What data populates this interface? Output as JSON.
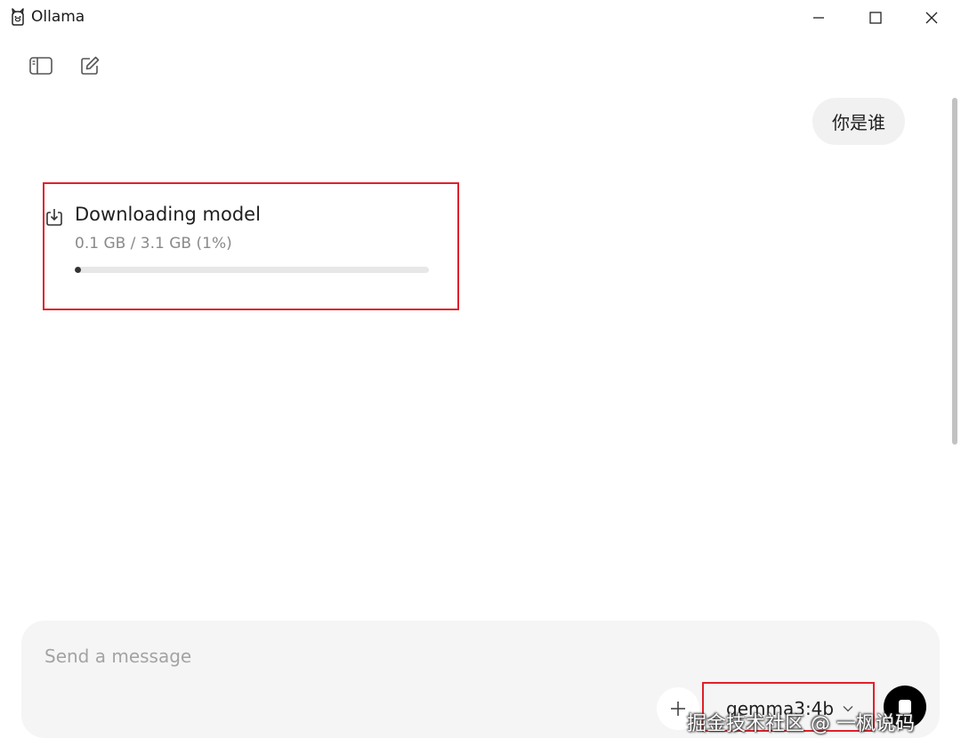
{
  "window": {
    "title": "Ollama",
    "app_icon": "llama-icon",
    "controls": [
      "minimize-icon",
      "maximize-icon",
      "close-icon"
    ]
  },
  "toolbar": {
    "sidebar_toggle_icon": "sidebar-icon",
    "new_chat_icon": "edit-icon"
  },
  "conversation": {
    "user_message": "你是谁",
    "download": {
      "icon": "download-icon",
      "title": "Downloading model",
      "progress_text": "0.1 GB / 3.1 GB (1%)",
      "progress_fraction": 0.01
    }
  },
  "composer": {
    "placeholder": "Send a message",
    "value": "",
    "attach_icon": "plus-icon",
    "model": "gemma3:4b",
    "model_dropdown_icon": "chevron-down-icon",
    "send_icon": "stop-icon"
  },
  "annotations": {
    "highlight_color": "#e0202a"
  },
  "watermark": "掘金技术社区 @ 一枫说码"
}
